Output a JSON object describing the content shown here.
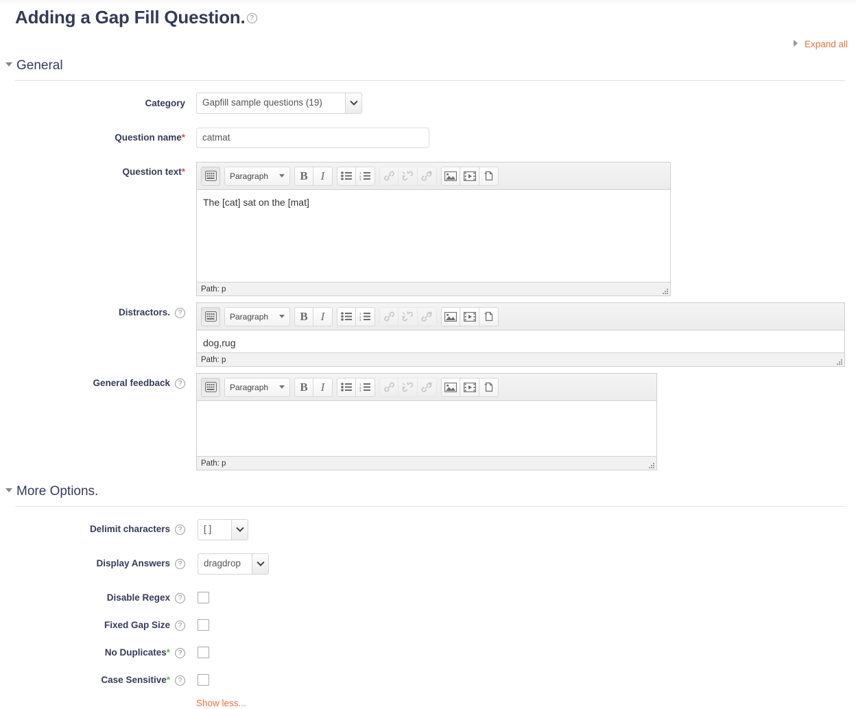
{
  "page": {
    "title": "Adding a Gap Fill Question.",
    "title_help_icon": "help-circle-icon",
    "expand_all": "Expand all",
    "show_less": "Show less..."
  },
  "colors": {
    "heading": "#343b58",
    "accent_link": "#e8733a",
    "required_red": "#d9534f",
    "advanced_green": "#5cb85c",
    "editor_border": "#cfcfcf"
  },
  "sections": [
    {
      "id": "general",
      "label": "General"
    },
    {
      "id": "more_options",
      "label": "More Options."
    }
  ],
  "fields": {
    "category": {
      "label": "Category",
      "value": "Gapfill sample questions (19)",
      "options": [
        "Gapfill sample questions (19)"
      ]
    },
    "question_name": {
      "label": "Question name",
      "required_marker": "*",
      "value": "catmat",
      "placeholder": ""
    },
    "question_text": {
      "label": "Question text",
      "required_marker": "*",
      "format": "Paragraph",
      "value": "The [cat] sat on the [mat]",
      "status": "Path: p"
    },
    "distractors": {
      "label": "Distractors.",
      "help_icon": "help-circle-icon",
      "format": "Paragraph",
      "value": "dog,rug",
      "status": "Path: p"
    },
    "general_feedback": {
      "label": "General feedback",
      "help_icon": "help-circle-icon",
      "format": "Paragraph",
      "value": "",
      "status": "Path: p"
    },
    "delimit_characters": {
      "label": "Delimit characters",
      "help_icon": "help-circle-icon",
      "value": "[ ]",
      "options": [
        "[ ]"
      ]
    },
    "display_answers": {
      "label": "Display Answers",
      "help_icon": "help-circle-icon",
      "value": "dragdrop",
      "options": [
        "dragdrop"
      ]
    },
    "disable_regex": {
      "label": "Disable Regex",
      "help_icon": "help-circle-icon",
      "checked": false
    },
    "fixed_gap_size": {
      "label": "Fixed Gap Size",
      "help_icon": "help-circle-icon",
      "checked": false
    },
    "no_duplicates": {
      "label": "No Duplicates",
      "advanced_marker": "*",
      "help_icon": "help-circle-icon",
      "checked": false
    },
    "case_sensitive": {
      "label": "Case Sensitive",
      "advanced_marker": "*",
      "help_icon": "help-circle-icon",
      "checked": false
    }
  },
  "editor_toolbar": {
    "buttons": [
      {
        "name": "toggle-toolbars-icon",
        "title": "Toggle toolbars",
        "state": "pressed"
      },
      {
        "name": "paragraph-format-select",
        "title": "Paragraph",
        "state": "normal"
      },
      {
        "name": "bold-icon",
        "title": "Bold",
        "state": "normal"
      },
      {
        "name": "italic-icon",
        "title": "Italic",
        "state": "normal"
      },
      {
        "name": "bullet-list-icon",
        "title": "Unordered list",
        "state": "normal"
      },
      {
        "name": "numbered-list-icon",
        "title": "Ordered list",
        "state": "normal"
      },
      {
        "name": "link-icon",
        "title": "Link",
        "state": "disabled"
      },
      {
        "name": "unlink-icon",
        "title": "Unlink",
        "state": "disabled"
      },
      {
        "name": "anchor-icon",
        "title": "Anchor",
        "state": "disabled"
      },
      {
        "name": "image-icon",
        "title": "Image",
        "state": "normal"
      },
      {
        "name": "media-icon",
        "title": "Media",
        "state": "normal"
      },
      {
        "name": "manage-files-icon",
        "title": "Manage files",
        "state": "normal"
      }
    ]
  }
}
